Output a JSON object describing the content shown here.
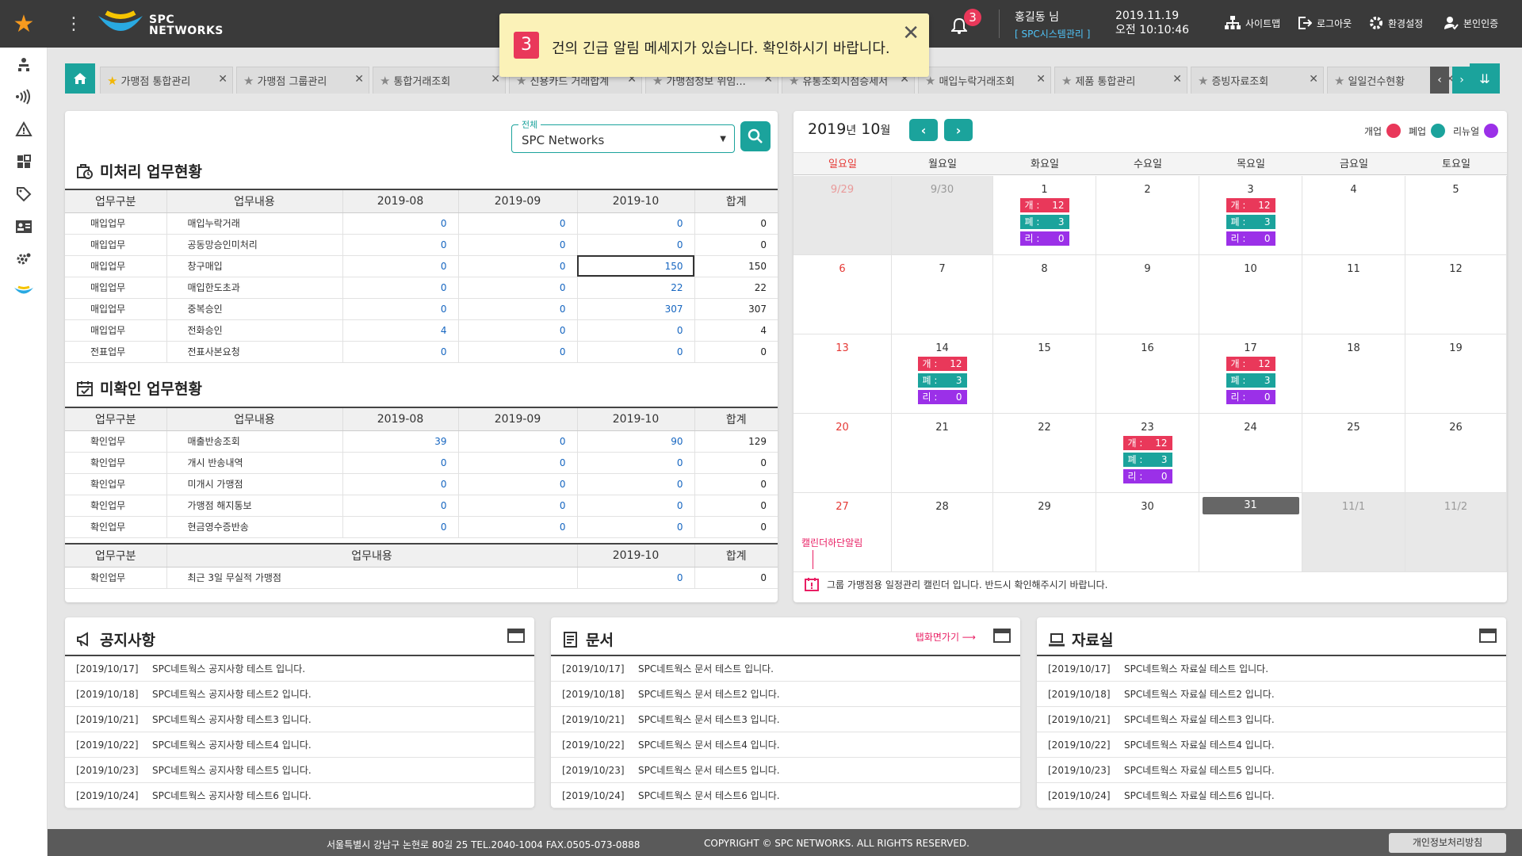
{
  "header": {
    "logo_text_line1": "SPC",
    "logo_text_line2": "NETWORKS",
    "notification_count": "3",
    "user_name": "홍길동 님",
    "user_role": "[ SPC시스템관리 ]",
    "date": "2019.11.19",
    "time": "오전 10:10:46",
    "buttons": {
      "sitemap": "사이트맵",
      "logout": "로그아웃",
      "settings": "환경설정",
      "auth": "본인인증"
    }
  },
  "alert": {
    "count": "3",
    "message": "건의 긴급 알림 메세지가 있습니다. 확인하시기 바랍니다."
  },
  "tabs": [
    {
      "label": "가맹점 통합관리",
      "fav": true
    },
    {
      "label": "가맹점 그룹관리",
      "fav": false
    },
    {
      "label": "통합거래조회",
      "fav": false
    },
    {
      "label": "신용카드 거래합계",
      "fav": false
    },
    {
      "label": "가맹점정보 위임...",
      "fav": false
    },
    {
      "label": "유통조회시점승세서",
      "fav": false
    },
    {
      "label": "매입누락거래조회",
      "fav": false
    },
    {
      "label": "제품 통합관리",
      "fav": false
    },
    {
      "label": "증빙자료조회",
      "fav": false
    },
    {
      "label": "일일건수현황",
      "fav": false
    }
  ],
  "work": {
    "select_label": "전체",
    "select_value": "SPC Networks",
    "pending_title": "미처리 업무현황",
    "unconfirmed_title": "미확인 업무현황",
    "headers": [
      "업무구분",
      "업무내용",
      "2019-08",
      "2019-09",
      "2019-10",
      "합계"
    ],
    "pending_rows": [
      [
        "매입업무",
        "매입누락거래",
        "0",
        "0",
        "0",
        "0"
      ],
      [
        "매입업무",
        "공동망승인미처리",
        "0",
        "0",
        "0",
        "0"
      ],
      [
        "매입업무",
        "창구매입",
        "0",
        "0",
        "150",
        "150"
      ],
      [
        "매입업무",
        "매입한도초과",
        "0",
        "0",
        "22",
        "22"
      ],
      [
        "매입업무",
        "중복승인",
        "0",
        "0",
        "307",
        "307"
      ],
      [
        "매입업무",
        "전화승인",
        "4",
        "0",
        "0",
        "4"
      ],
      [
        "전표업무",
        "전표사본요청",
        "0",
        "0",
        "0",
        "0"
      ]
    ],
    "unconfirmed_rows": [
      [
        "확인업무",
        "매출반송조회",
        "39",
        "0",
        "90",
        "129"
      ],
      [
        "확인업무",
        "개시 반송내역",
        "0",
        "0",
        "0",
        "0"
      ],
      [
        "확인업무",
        "미개시 가맹점",
        "0",
        "0",
        "0",
        "0"
      ],
      [
        "확인업무",
        "가맹점 해지통보",
        "0",
        "0",
        "0",
        "0"
      ],
      [
        "확인업무",
        "현금영수증반송",
        "0",
        "0",
        "0",
        "0"
      ]
    ],
    "extra_headers": [
      "업무구분",
      "업무내용",
      "2019-10",
      "합계"
    ],
    "extra_row": [
      "확인업무",
      "최근 3일 무실적 가맹점",
      "0",
      "0"
    ]
  },
  "calendar": {
    "year": "2019",
    "year_suffix": "년",
    "month": "10",
    "month_suffix": "월",
    "legend": [
      {
        "label": "개업",
        "color": "#e9385a"
      },
      {
        "label": "폐업",
        "color": "#1ba39c"
      },
      {
        "label": "리뉴얼",
        "color": "#9b30e8"
      }
    ],
    "dow": [
      "일요일",
      "월요일",
      "화요일",
      "수요일",
      "목요일",
      "금요일",
      "토요일"
    ],
    "event_labels": {
      "open": "개 :",
      "close": "폐 :",
      "renew": "리 :"
    },
    "weeks": [
      [
        {
          "d": "9/29",
          "m": true
        },
        {
          "d": "9/30",
          "m": true
        },
        {
          "d": "1",
          "ev": [
            "12",
            "3",
            "0"
          ]
        },
        {
          "d": "2"
        },
        {
          "d": "3",
          "ev": [
            "12",
            "3",
            "0"
          ]
        },
        {
          "d": "4"
        },
        {
          "d": "5"
        }
      ],
      [
        {
          "d": "6"
        },
        {
          "d": "7"
        },
        {
          "d": "8"
        },
        {
          "d": "9"
        },
        {
          "d": "10"
        },
        {
          "d": "11"
        },
        {
          "d": "12"
        }
      ],
      [
        {
          "d": "13"
        },
        {
          "d": "14",
          "ev": [
            "12",
            "3",
            "0"
          ]
        },
        {
          "d": "15"
        },
        {
          "d": "16"
        },
        {
          "d": "17",
          "ev": [
            "12",
            "3",
            "0"
          ]
        },
        {
          "d": "18"
        },
        {
          "d": "19"
        }
      ],
      [
        {
          "d": "20"
        },
        {
          "d": "21"
        },
        {
          "d": "22"
        },
        {
          "d": "23",
          "ev": [
            "12",
            "3",
            "0"
          ]
        },
        {
          "d": "24"
        },
        {
          "d": "25"
        },
        {
          "d": "26"
        }
      ],
      [
        {
          "d": "27"
        },
        {
          "d": "28"
        },
        {
          "d": "29"
        },
        {
          "d": "30"
        },
        {
          "d": "31",
          "today": true
        },
        {
          "d": "11/1",
          "m": true
        },
        {
          "d": "11/2",
          "m": true
        }
      ]
    ],
    "annotation": "캘린더하단알림",
    "note": "그룹 가맹점용 일정관리 캘린더 입니다. 반드시 확인해주시기 바랍니다."
  },
  "boards": [
    {
      "title": "공지사항",
      "icon": "megaphone-icon",
      "annotation": "",
      "items": [
        [
          "[2019/10/17]",
          "SPC네트웍스 공지사항 테스트 입니다."
        ],
        [
          "[2019/10/18]",
          "SPC네트웍스 공지사항 테스트2 입니다."
        ],
        [
          "[2019/10/21]",
          "SPC네트웍스 공지사항 테스트3 입니다."
        ],
        [
          "[2019/10/22]",
          "SPC네트웍스 공지사항 테스트4 입니다."
        ],
        [
          "[2019/10/23]",
          "SPC네트웍스 공지사항 테스트5 입니다."
        ],
        [
          "[2019/10/24]",
          "SPC네트웍스 공지사항 테스트6 입니다."
        ]
      ]
    },
    {
      "title": "문서",
      "icon": "document-icon",
      "annotation": "탭화면가기 ⟶",
      "items": [
        [
          "[2019/10/17]",
          "SPC네트웍스 문서 테스트 입니다."
        ],
        [
          "[2019/10/18]",
          "SPC네트웍스 문서 테스트2 입니다."
        ],
        [
          "[2019/10/21]",
          "SPC네트웍스 문서 테스트3 입니다."
        ],
        [
          "[2019/10/22]",
          "SPC네트웍스 문서 테스트4 입니다."
        ],
        [
          "[2019/10/23]",
          "SPC네트웍스 문서 테스트5 입니다."
        ],
        [
          "[2019/10/24]",
          "SPC네트웍스 문서 테스트6 입니다."
        ]
      ]
    },
    {
      "title": "자료실",
      "icon": "laptop-icon",
      "annotation": "",
      "items": [
        [
          "[2019/10/17]",
          "SPC네트웍스 자료실 테스트 입니다."
        ],
        [
          "[2019/10/18]",
          "SPC네트웍스 자료실 테스트2 입니다."
        ],
        [
          "[2019/10/21]",
          "SPC네트웍스 자료실 테스트3 입니다."
        ],
        [
          "[2019/10/22]",
          "SPC네트웍스 자료실 테스트4 입니다."
        ],
        [
          "[2019/10/23]",
          "SPC네트웍스 자료실 테스트5 입니다."
        ],
        [
          "[2019/10/24]",
          "SPC네트웍스 자료실 테스트6 입니다."
        ]
      ]
    }
  ],
  "footer": {
    "address": "서울특별시 강남구 논현로 80길 25 TEL.2040-1004 FAX.0505-073-0888",
    "copyright": "COPYRIGHT © SPC NETWORKS. ALL RIGHTS RESERVED.",
    "privacy": "개인정보처리방침"
  }
}
